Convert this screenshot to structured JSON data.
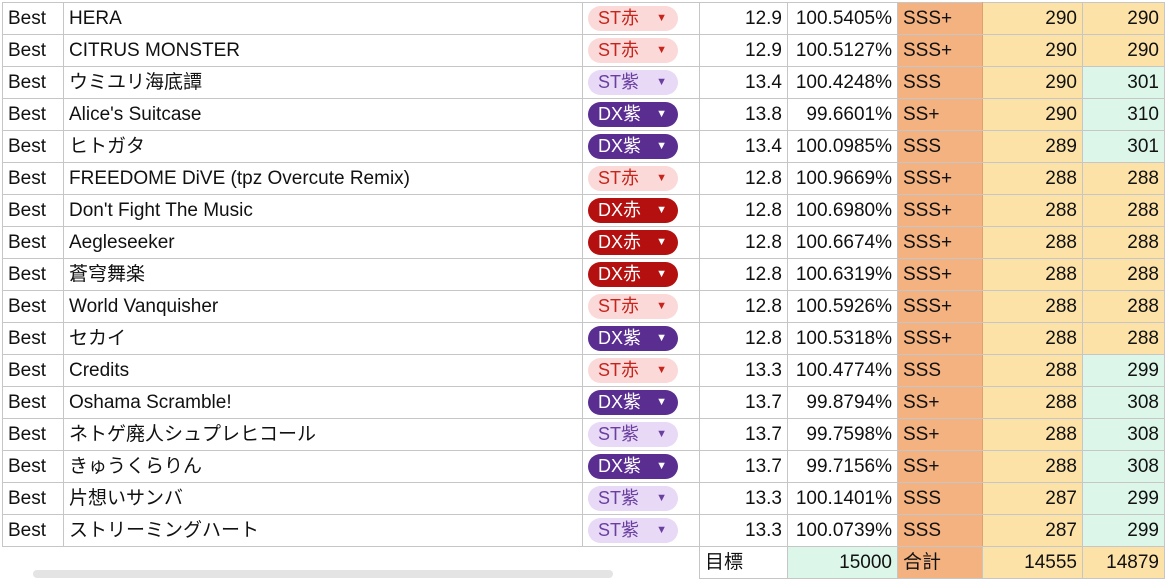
{
  "rows": [
    {
      "type": "Best",
      "title": "HERA",
      "chart": "ST赤",
      "chip_class": "st-red",
      "level": "12.9",
      "score": "100.5405%",
      "rank": "SSS+",
      "rating": "290",
      "best": "290"
    },
    {
      "type": "Best",
      "title": "CITRUS MONSTER",
      "chart": "ST赤",
      "chip_class": "st-red",
      "level": "12.9",
      "score": "100.5127%",
      "rank": "SSS+",
      "rating": "290",
      "best": "290"
    },
    {
      "type": "Best",
      "title": "ウミユリ海底譚",
      "chart": "ST紫",
      "chip_class": "st-purple",
      "level": "13.4",
      "score": "100.4248%",
      "rank": "SSS",
      "rating": "290",
      "best": "301"
    },
    {
      "type": "Best",
      "title": "Alice's Suitcase",
      "chart": "DX紫",
      "chip_class": "dx-purple",
      "level": "13.8",
      "score": "99.6601%",
      "rank": "SS+",
      "rating": "290",
      "best": "310"
    },
    {
      "type": "Best",
      "title": "ヒトガタ",
      "chart": "DX紫",
      "chip_class": "dx-purple",
      "level": "13.4",
      "score": "100.0985%",
      "rank": "SSS",
      "rating": "289",
      "best": "301"
    },
    {
      "type": "Best",
      "title": "FREEDOME DiVE (tpz Overcute Remix)",
      "chart": "ST赤",
      "chip_class": "st-red",
      "level": "12.8",
      "score": "100.9669%",
      "rank": "SSS+",
      "rating": "288",
      "best": "288"
    },
    {
      "type": "Best",
      "title": "Don't Fight The Music",
      "chart": "DX赤",
      "chip_class": "dx-red",
      "level": "12.8",
      "score": "100.6980%",
      "rank": "SSS+",
      "rating": "288",
      "best": "288"
    },
    {
      "type": "Best",
      "title": "Aegleseeker",
      "chart": "DX赤",
      "chip_class": "dx-red",
      "level": "12.8",
      "score": "100.6674%",
      "rank": "SSS+",
      "rating": "288",
      "best": "288"
    },
    {
      "type": "Best",
      "title": "蒼穹舞楽",
      "chart": "DX赤",
      "chip_class": "dx-red",
      "level": "12.8",
      "score": "100.6319%",
      "rank": "SSS+",
      "rating": "288",
      "best": "288"
    },
    {
      "type": "Best",
      "title": "World Vanquisher",
      "chart": "ST赤",
      "chip_class": "st-red",
      "level": "12.8",
      "score": "100.5926%",
      "rank": "SSS+",
      "rating": "288",
      "best": "288"
    },
    {
      "type": "Best",
      "title": "セカイ",
      "chart": "DX紫",
      "chip_class": "dx-purple",
      "level": "12.8",
      "score": "100.5318%",
      "rank": "SSS+",
      "rating": "288",
      "best": "288"
    },
    {
      "type": "Best",
      "title": "Credits",
      "chart": "ST赤",
      "chip_class": "st-red",
      "level": "13.3",
      "score": "100.4774%",
      "rank": "SSS",
      "rating": "288",
      "best": "299"
    },
    {
      "type": "Best",
      "title": "Oshama Scramble!",
      "chart": "DX紫",
      "chip_class": "dx-purple",
      "level": "13.7",
      "score": "99.8794%",
      "rank": "SS+",
      "rating": "288",
      "best": "308"
    },
    {
      "type": "Best",
      "title": "ネトゲ廃人シュプレヒコール",
      "chart": "ST紫",
      "chip_class": "st-purple",
      "level": "13.7",
      "score": "99.7598%",
      "rank": "SS+",
      "rating": "288",
      "best": "308"
    },
    {
      "type": "Best",
      "title": "きゅうくらりん",
      "chart": "DX紫",
      "chip_class": "dx-purple",
      "level": "13.7",
      "score": "99.7156%",
      "rank": "SS+",
      "rating": "288",
      "best": "308"
    },
    {
      "type": "Best",
      "title": "片想いサンバ",
      "chart": "ST紫",
      "chip_class": "st-purple",
      "level": "13.3",
      "score": "100.1401%",
      "rank": "SSS",
      "rating": "287",
      "best": "299"
    },
    {
      "type": "Best",
      "title": "ストリーミングハート",
      "chart": "ST紫",
      "chip_class": "st-purple",
      "level": "13.3",
      "score": "100.0739%",
      "rank": "SSS",
      "rating": "287",
      "best": "299"
    }
  ],
  "footer": {
    "goal_label": "目標",
    "goal_value": "15000",
    "total_label": "合計",
    "total_rating": "14555",
    "total_best": "14879"
  },
  "icons": {
    "dropdown": "dropdown-arrow-icon"
  },
  "colors": {
    "rank_bg": "#f3b27f",
    "rating_bg": "#fde2a8",
    "improved_bg": "#dcf7ea",
    "st_red": "#fcd9d9",
    "st_purple": "#e8d9f6",
    "dx_purple": "#5a2d91",
    "dx_red": "#b3100f"
  }
}
